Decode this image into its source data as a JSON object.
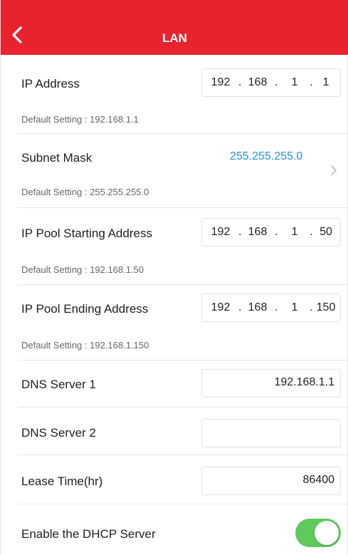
{
  "header": {
    "title": "LAN"
  },
  "ip_address": {
    "label": "IP Address",
    "octets": [
      "192",
      "168",
      "1",
      "1"
    ],
    "hint": "Default Setting : 192.168.1.1"
  },
  "subnet_mask": {
    "label": "Subnet Mask",
    "value": "255.255.255.0",
    "hint": "Default Setting : 255.255.255.0"
  },
  "pool_start": {
    "label": "IP Pool Starting Address",
    "octets": [
      "192",
      "168",
      "1",
      "50"
    ],
    "hint": "Default Setting : 192.168.1.50"
  },
  "pool_end": {
    "label": "IP Pool Ending Address",
    "octets": [
      "192",
      "168",
      "1",
      "150"
    ],
    "hint": "Default Setting : 192.168.1.150"
  },
  "dns1": {
    "label": "DNS Server 1",
    "value": "192.168.1.1"
  },
  "dns2": {
    "label": "DNS Server 2",
    "value": ""
  },
  "lease": {
    "label": "Lease Time(hr)",
    "value": "86400"
  },
  "dhcp": {
    "label": "Enable the DHCP Server",
    "enabled": true
  },
  "colors": {
    "header": "#e8232e",
    "link": "#2a8ee0",
    "toggle_on": "#5fc95c"
  },
  "icons": {
    "back": "chevron-left-icon",
    "subnet_arrow": "chevron-right-icon"
  }
}
